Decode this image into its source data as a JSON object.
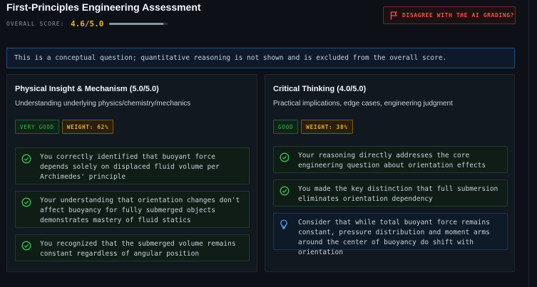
{
  "header": {
    "title": "First-Principles Engineering Assessment",
    "overall_label": "OVERALL SCORE:",
    "overall_value": "4.6/5.0",
    "overall_fraction": 0.92,
    "disagree_label": "DISAGREE WITH THE AI GRADING?"
  },
  "notice": "This is a conceptual question; quantitative reasoning is not shown and is excluded from the overall score.",
  "left": {
    "title": "Physical Insight & Mechanism (5.0/5.0)",
    "subtitle": "Understanding underlying physics/chemistry/mechanics",
    "rating": "VERY GOOD",
    "weight": "WEIGHT: 62%",
    "items": [
      "You correctly identified that buoyant force depends solely on displaced fluid volume per Archimedes' principle",
      "Your understanding that orientation changes don't affect buoyancy for fully submerged objects demonstrates mastery of fluid statics",
      "You recognized that the submerged volume remains constant regardless of angular position"
    ]
  },
  "right": {
    "title": "Critical Thinking (4.0/5.0)",
    "subtitle": "Practical implications, edge cases, engineering judgment",
    "rating": "GOOD",
    "weight": "WEIGHT: 38%",
    "items": [
      "Your reasoning directly addresses the core engineering question about orientation effects",
      "You made the key distinction that full submersion eliminates orientation dependency"
    ],
    "tip": "Consider that while total buoyant force remains constant, pressure distribution and moment arms around the center of buoyancy do shift with orientation"
  },
  "colors": {
    "accent_green": "#3fb950",
    "accent_amber": "#e3b341",
    "danger": "#f85149",
    "info": "#58a6ff"
  }
}
